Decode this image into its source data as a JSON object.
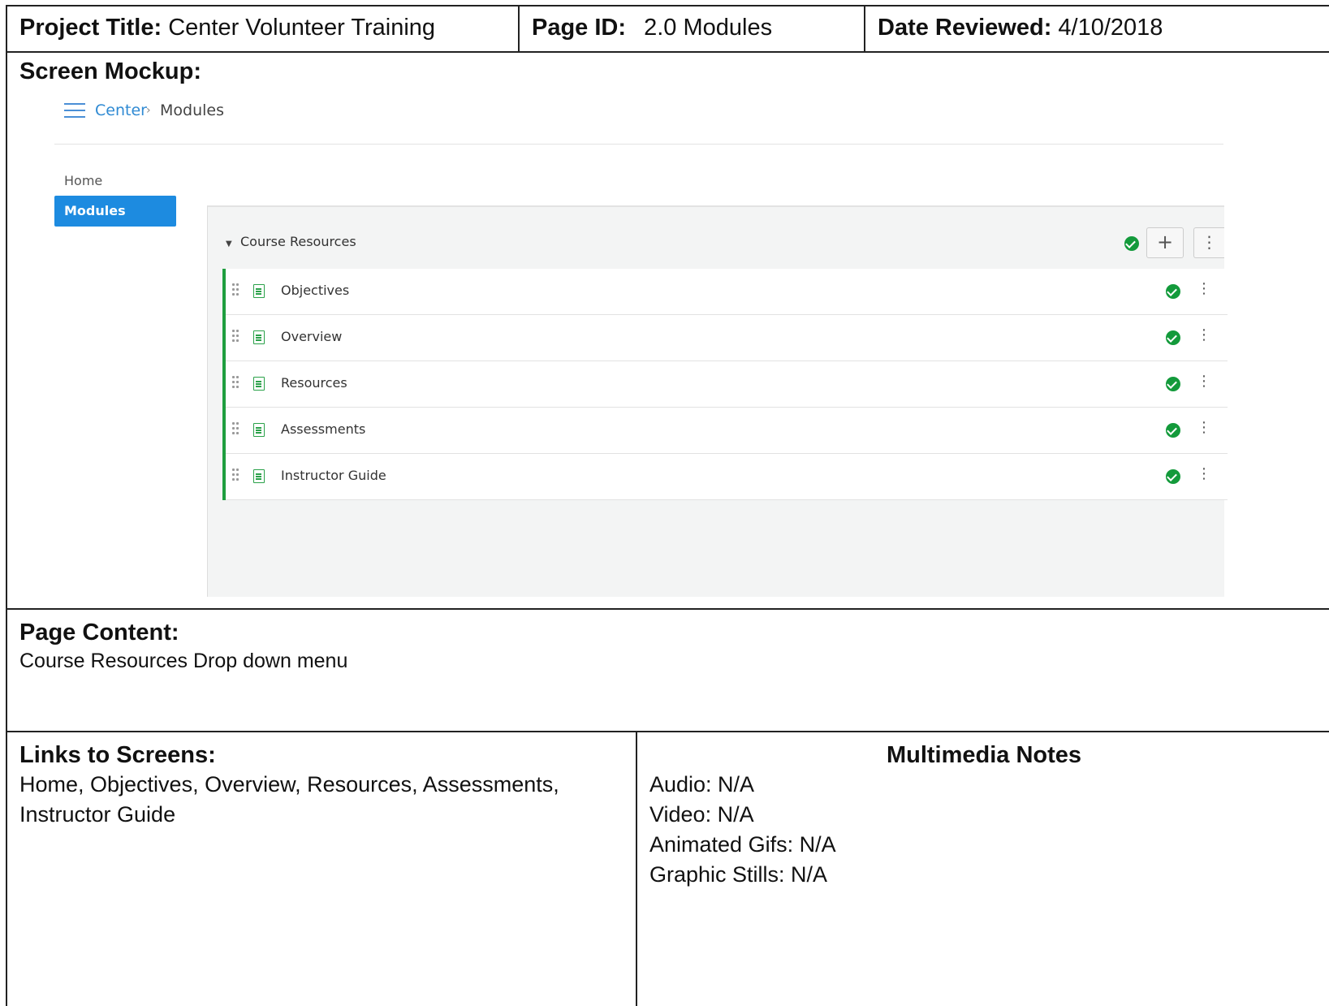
{
  "header": {
    "project_label": "Project Title:",
    "project_value": "Center Volunteer Training",
    "page_id_label": "Page ID:",
    "page_id_value": "2.0 Modules",
    "date_label": "Date Reviewed:",
    "date_value": "4/10/2018"
  },
  "mockup": {
    "label": "Screen Mockup:",
    "breadcrumb": {
      "root": "Center",
      "separator": "›",
      "current": "Modules"
    },
    "nav": {
      "home": "Home",
      "modules": "Modules"
    },
    "module": {
      "title": "Course Resources",
      "items": [
        {
          "label": "Objectives"
        },
        {
          "label": "Overview"
        },
        {
          "label": "Resources"
        },
        {
          "label": "Assessments"
        },
        {
          "label": "Instructor Guide"
        }
      ]
    },
    "accent_color": "#1d8be0",
    "complete_color": "#139a3b"
  },
  "page_content": {
    "label": "Page Content:",
    "text": "Course Resources Drop down menu"
  },
  "links": {
    "label": "Links to Screens:",
    "line1": "Home, Objectives, Overview, Resources, Assessments,",
    "line2": "Instructor Guide"
  },
  "multimedia": {
    "label": "Multimedia Notes",
    "audio": "Audio: N/A",
    "video": "Video: N/A",
    "gifs": "Animated Gifs: N/A",
    "stills": "Graphic Stills: N/A"
  }
}
